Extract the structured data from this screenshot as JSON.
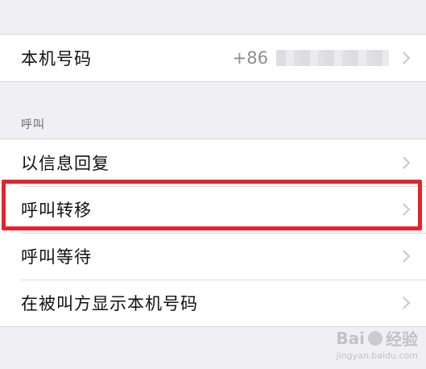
{
  "top_group": {
    "phone_row": {
      "label": "本机号码",
      "value_prefix": "+86"
    }
  },
  "call_section": {
    "header": "呼叫",
    "items": [
      {
        "label": "以信息回复"
      },
      {
        "label": "呼叫转移",
        "highlighted": true
      },
      {
        "label": "呼叫等待"
      },
      {
        "label": "在被叫方显示本机号码"
      }
    ]
  },
  "annotation": {
    "highlight_color": "#e8222a"
  },
  "watermark": {
    "main": "Bai",
    "brand": "经验",
    "sub": "jingyan.baidu.com"
  },
  "icons": {
    "chevron": "chevron-right-icon",
    "paw": "baidu-paw-icon"
  },
  "colors": {
    "background": "#efeff4",
    "cell": "#ffffff",
    "chevron": "#c7c7cc",
    "secondary_text": "#8e8e93"
  }
}
